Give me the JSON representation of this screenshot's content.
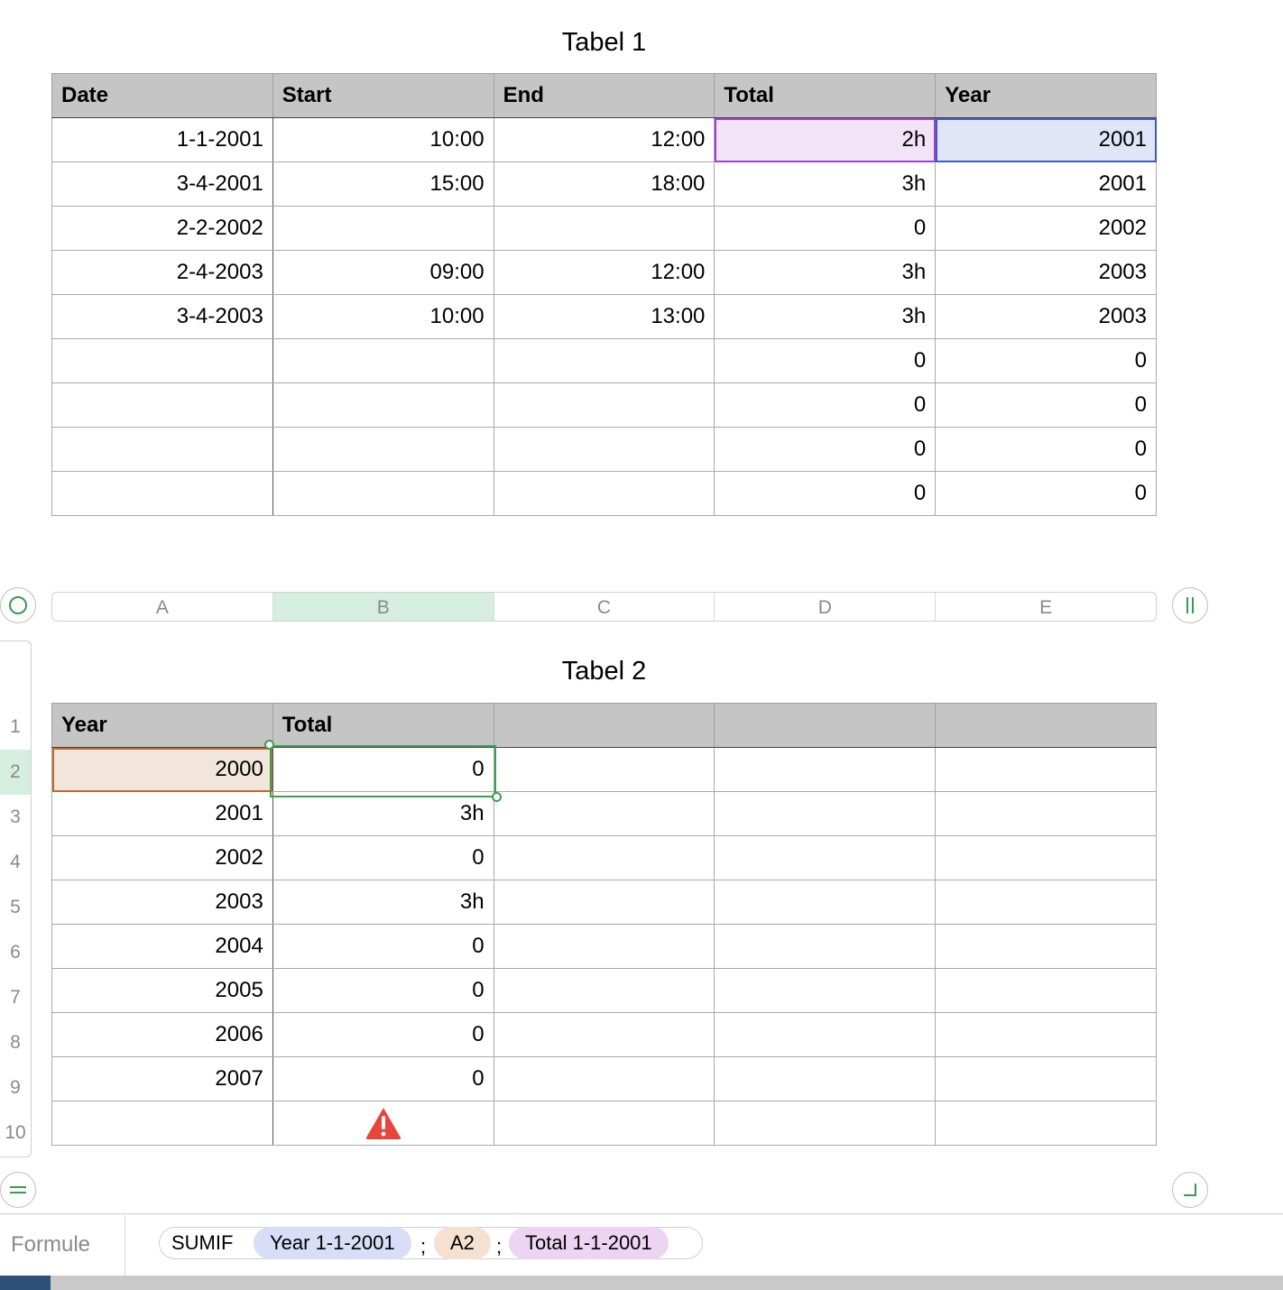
{
  "tabel1": {
    "title": "Tabel 1",
    "headers": [
      "Date",
      "Start",
      "End",
      "Total",
      "Year"
    ],
    "rows": [
      [
        "1-1-2001",
        "10:00",
        "12:00",
        "2h",
        "2001"
      ],
      [
        "3-4-2001",
        "15:00",
        "18:00",
        "3h",
        "2001"
      ],
      [
        "2-2-2002",
        "",
        "",
        "0",
        "2002"
      ],
      [
        "2-4-2003",
        "09:00",
        "12:00",
        "3h",
        "2003"
      ],
      [
        "3-4-2003",
        "10:00",
        "13:00",
        "3h",
        "2003"
      ],
      [
        "",
        "",
        "",
        "0",
        "0"
      ],
      [
        "",
        "",
        "",
        "0",
        "0"
      ],
      [
        "",
        "",
        "",
        "0",
        "0"
      ],
      [
        "",
        "",
        "",
        "0",
        "0"
      ]
    ]
  },
  "column_letters": [
    "A",
    "B",
    "C",
    "D",
    "E"
  ],
  "row_numbers": [
    "1",
    "2",
    "3",
    "4",
    "5",
    "6",
    "7",
    "8",
    "9",
    "10"
  ],
  "tabel2": {
    "title": "Tabel 2",
    "headers": [
      "Year",
      "Total",
      "",
      "",
      ""
    ],
    "rows": [
      [
        "2000",
        "0",
        "",
        "",
        ""
      ],
      [
        "2001",
        "3h",
        "",
        "",
        ""
      ],
      [
        "2002",
        "0",
        "",
        "",
        ""
      ],
      [
        "2003",
        "3h",
        "",
        "",
        ""
      ],
      [
        "2004",
        "0",
        "",
        "",
        ""
      ],
      [
        "2005",
        "0",
        "",
        "",
        ""
      ],
      [
        "2006",
        "0",
        "",
        "",
        ""
      ],
      [
        "2007",
        "0",
        "",
        "",
        ""
      ],
      [
        "",
        "",
        "",
        "",
        ""
      ]
    ]
  },
  "formula_bar": {
    "label": "Formule",
    "function": "SUMIF",
    "arg1": "Year 1-1-2001",
    "sep1": ";",
    "arg2": "A2",
    "sep2": ";",
    "arg3": "Total 1-1-2001"
  },
  "colors": {
    "total_ref": "#f2e3f7",
    "year_ref": "#e0e6f8",
    "a2_ref": "#f2e6dc",
    "selection": "#3aa050",
    "warning": "#e8453c"
  },
  "icons": [
    "warning-icon",
    "table-select-icon",
    "pause-icon",
    "equals-icon",
    "resize-corner-icon"
  ]
}
